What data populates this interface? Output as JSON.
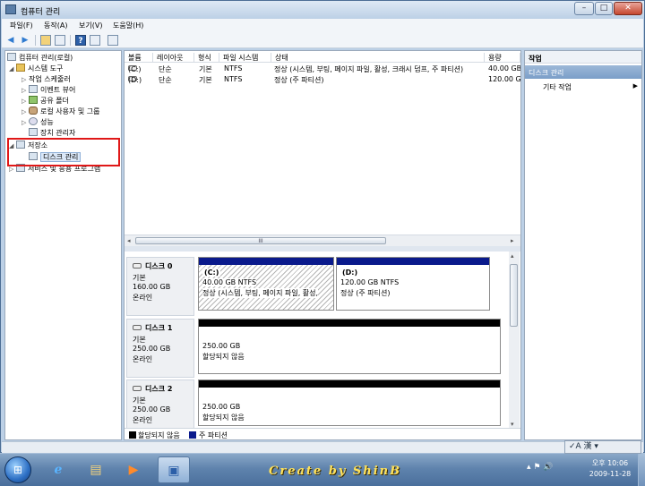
{
  "window": {
    "title": "컴퓨터 관리",
    "buttons": {
      "minimize": "–",
      "maximize": "□",
      "close": "✕"
    }
  },
  "menubar": {
    "items": [
      "파일(F)",
      "동작(A)",
      "보기(V)",
      "도움말(H)"
    ]
  },
  "toolbar": {
    "back_icon": "back-arrow-icon",
    "forward_icon": "forward-arrow-icon",
    "glyphs": {
      "back": "◀",
      "forward": "▶",
      "help": "?"
    }
  },
  "tree": {
    "root": "컴퓨터 관리(로컬)",
    "system_tools": "시스템 도구",
    "task_scheduler": "작업 스케줄러",
    "event_viewer": "이벤트 뷰어",
    "shared_folders": "공유 폴더",
    "local_users": "로컬 사용자 및 그룹",
    "performance": "성능",
    "device_manager": "장치 관리자",
    "storage": "저장소",
    "disk_management": "디스크 관리",
    "services": "서비스 및 응용 프로그램",
    "glyphs": {
      "expanded": "◢",
      "collapsed": "▷"
    }
  },
  "volume_list": {
    "columns": [
      "볼륨",
      "레이아웃",
      "형식",
      "파일 시스템",
      "상태",
      "용량"
    ],
    "rows": [
      {
        "volume": "(C:)",
        "layout": "단순",
        "type": "기본",
        "fs": "NTFS",
        "status": "정상 (시스템, 부팅, 페이지 파일, 활성, 크래시 덤프, 주 파티션)",
        "capacity": "40.00 GB"
      },
      {
        "volume": "(D:)",
        "layout": "단순",
        "type": "기본",
        "fs": "NTFS",
        "status": "정상 (주 파티션)",
        "capacity": "120.00 GB"
      }
    ],
    "scroll_thumb_label": "III",
    "scroll_glyphs": {
      "left": "◂",
      "right": "▸",
      "up": "▴",
      "down": "▾"
    }
  },
  "disks": [
    {
      "name": "디스크 0",
      "kind": "기본",
      "size": "160.00 GB",
      "state": "온라인",
      "partitions": [
        {
          "label": "(C:)",
          "detail": "40.00 GB NTFS",
          "status": "정상 (시스템, 부팅, 페이지 파일, 활성,"
        },
        {
          "label": "(D:)",
          "detail": "120.00 GB NTFS",
          "status": "정상 (주 파티션)"
        }
      ]
    },
    {
      "name": "디스크 1",
      "kind": "기본",
      "size": "250.00 GB",
      "state": "온라인",
      "partitions": [
        {
          "detail": "250.00 GB",
          "status": "할당되지 않음"
        }
      ]
    },
    {
      "name": "디스크 2",
      "kind": "기본",
      "size": "250.00 GB",
      "state": "온라인",
      "partitions": [
        {
          "detail": "250.00 GB",
          "status": "할당되지 않음"
        }
      ]
    }
  ],
  "legend": {
    "unallocated": "할당되지 않음",
    "primary": "주 파티션",
    "unallocated_color": "#000000",
    "primary_color": "#0a1a8c"
  },
  "actions": {
    "header": "작업",
    "section": "디스크 관리",
    "more": "기타 작업",
    "more_arrow": "▶"
  },
  "taskbar": {
    "banner": "Create by ShinB",
    "langbar": "✓A 漢 ▾",
    "clock_time": "오후 10:06",
    "clock_date": "2009-11-28",
    "start_glyph": "⊞",
    "tray_glyphs": "▴ ⚑ 🔊",
    "app_glyphs": {
      "ie": "e",
      "explorer": "▤",
      "media": "▶",
      "computer_management": "▣"
    }
  }
}
